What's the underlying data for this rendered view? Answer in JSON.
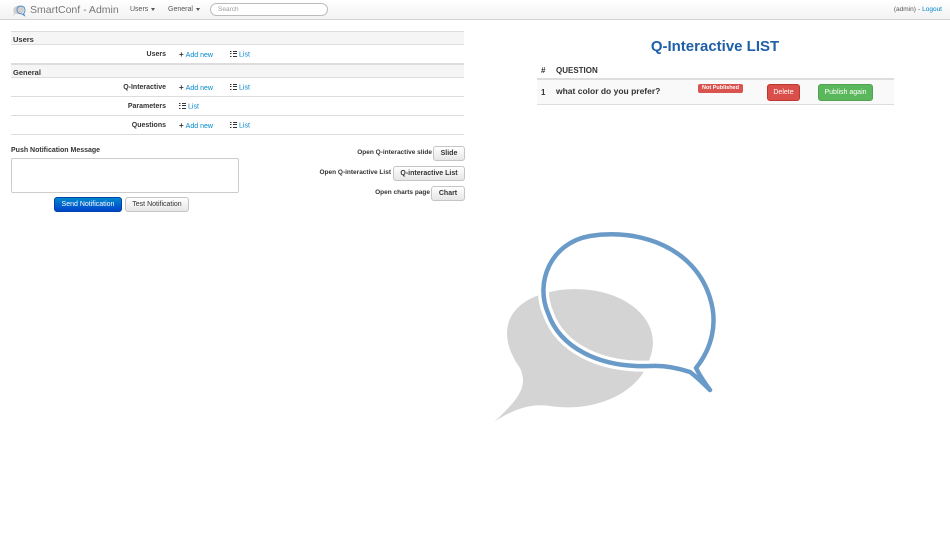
{
  "navbar": {
    "brand": "SmartConf - Admin",
    "menus": [
      {
        "label": "Users"
      },
      {
        "label": "General"
      }
    ],
    "search_placeholder": "Search",
    "user": "(admin)",
    "separator": "-",
    "logout": "Logout"
  },
  "admin_table": {
    "users_section": "Users",
    "users_row": {
      "label": "Users",
      "add_new": "Add new",
      "list": "List"
    },
    "general_section": "General",
    "qinteractive_row": {
      "label": "Q-Interactive",
      "add_new": "Add new",
      "list": "List"
    },
    "parameters_row": {
      "label": "Parameters",
      "list": "List"
    },
    "questions_row": {
      "label": "Questions",
      "add_new": "Add new",
      "list": "List"
    }
  },
  "push": {
    "label": "Push Notification Message",
    "message_value": "",
    "send_button": "Send Notification",
    "test_button": "Test Notification"
  },
  "open_actions": {
    "slide": {
      "label": "Open Q-interactive slide",
      "button": "Slide"
    },
    "list": {
      "label": "Open Q-interactive List",
      "button": "Q-interactive List"
    },
    "chart": {
      "label": "Open charts page",
      "button": "Chart"
    }
  },
  "q_list": {
    "title": "Q-Interactive LIST",
    "columns": {
      "number": "#",
      "question": "QUESTION"
    },
    "rows": [
      {
        "number": "1",
        "question": "what color do you prefer?",
        "status": "Not Published",
        "delete": "Delete",
        "publish": "Publish again"
      }
    ]
  },
  "colors": {
    "title_blue": "#1f5fa8",
    "link_blue": "#0088cc",
    "danger": "#da4f49",
    "success": "#5bb75b",
    "primary": "#0055cc",
    "bubble_outline": "#6a9bc8",
    "bubble_fill": "#d4d4d4"
  },
  "icons": {
    "brand": "chat-bubble-logo",
    "add": "plus-icon",
    "list": "list-icon",
    "watermark": "speech-bubbles-watermark"
  }
}
